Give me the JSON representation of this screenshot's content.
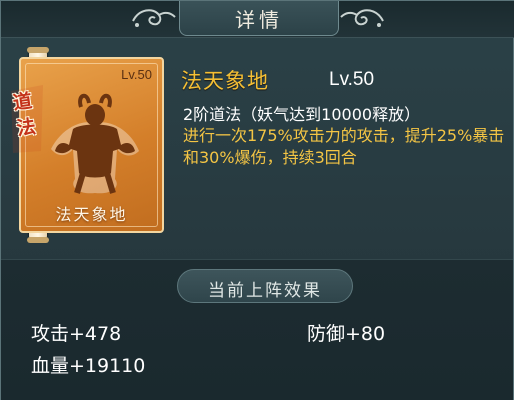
{
  "header": {
    "title": "详情"
  },
  "card": {
    "level": "Lv.50",
    "name": "法天象地",
    "tag": "道法"
  },
  "skill": {
    "name": "法天象地",
    "level": "Lv.50",
    "type_text": "2阶道法（妖气达到10000释放）",
    "description": "进行一次175%攻击力的攻击，提升25%暴击和30%爆伤，持续3回合"
  },
  "effects": {
    "title": "当前上阵效果",
    "attack": "攻击+478",
    "defense": "防御+80",
    "hp": "血量+19110"
  },
  "colors": {
    "background": "#27393f",
    "card_orange": "#d47f2a",
    "skill_name": "#f5bf34",
    "description": "#f4c544",
    "tag_red": "#c4321a"
  },
  "icons": [
    "scroll-ornament-icon",
    "demon-silhouette-icon",
    "seal-mark-icon"
  ]
}
